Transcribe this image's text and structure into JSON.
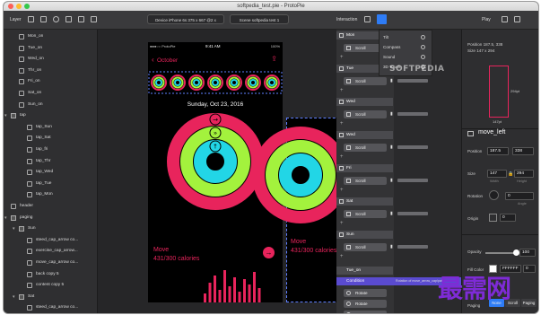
{
  "window": {
    "title": "softpedia_test.pie - ProtoPie",
    "traffic_colors": [
      "#fc5f57",
      "#fdbc2e",
      "#34c84a"
    ]
  },
  "toolbar": {
    "layer_label": "Layer",
    "device_label": "Device  iPhone 6s 375 x 667 @2 x",
    "scene_label": "Scene  softpedia test 1",
    "interaction_label": "Interaction",
    "play_label": "Play"
  },
  "layers": [
    {
      "name": "Mon_on",
      "indent": 1,
      "icon": "image-icon"
    },
    {
      "name": "Tue_on",
      "indent": 1,
      "icon": "image-icon"
    },
    {
      "name": "Wed_on",
      "indent": 1,
      "icon": "image-icon"
    },
    {
      "name": "Thr_on",
      "indent": 1,
      "icon": "image-icon"
    },
    {
      "name": "Fri_on",
      "indent": 1,
      "icon": "image-icon"
    },
    {
      "name": "Sat_on",
      "indent": 1,
      "icon": "image-icon"
    },
    {
      "name": "Sun_on",
      "indent": 1,
      "icon": "image-icon"
    },
    {
      "name": "tap",
      "indent": 0,
      "icon": "folder-icon"
    },
    {
      "name": "tap_Sun",
      "indent": 2,
      "icon": "rect-icon"
    },
    {
      "name": "tap_Sat",
      "indent": 2,
      "icon": "rect-icon"
    },
    {
      "name": "tap_fri",
      "indent": 2,
      "icon": "rect-icon"
    },
    {
      "name": "tap_Thr",
      "indent": 2,
      "icon": "rect-icon"
    },
    {
      "name": "tap_Wed",
      "indent": 2,
      "icon": "rect-icon"
    },
    {
      "name": "tap_Tue",
      "indent": 2,
      "icon": "rect-icon"
    },
    {
      "name": "tap_Mon",
      "indent": 2,
      "icon": "rect-icon"
    },
    {
      "name": "header",
      "indent": 0,
      "icon": "image-icon"
    },
    {
      "name": "paging",
      "indent": 0,
      "icon": "folder-icon"
    },
    {
      "name": "Sun",
      "indent": 1,
      "icon": "folder-icon"
    },
    {
      "name": "steed_cap_arrow co...",
      "indent": 2,
      "icon": "image-icon"
    },
    {
      "name": "exercise_cap_arrow...",
      "indent": 2,
      "icon": "image-icon"
    },
    {
      "name": "move_cap_arrow co...",
      "indent": 2,
      "icon": "image-icon"
    },
    {
      "name": "back copy 5",
      "indent": 2,
      "icon": "image-icon"
    },
    {
      "name": "content copy 5",
      "indent": 2,
      "icon": "image-icon"
    },
    {
      "name": "Sat",
      "indent": 1,
      "icon": "folder-icon"
    },
    {
      "name": "steed_cap_arrow co...",
      "indent": 2,
      "icon": "image-icon"
    }
  ],
  "phone": {
    "status_carrier": "●●●○○ ProtoPie",
    "status_time": "9:41 AM",
    "status_battery": "100%",
    "back_label": "October",
    "date": "Sunday, Oct 23, 2016",
    "move_label": "Move",
    "move_value": "431/300",
    "move_unit": "calories",
    "move2_label": "Move",
    "move2_value": "431/300",
    "move2_unit": "calories"
  },
  "interactions": [
    {
      "trigger": "Mon",
      "action": "Scroll"
    },
    {
      "trigger": "Tue",
      "action": "Scroll"
    },
    {
      "trigger": "Wed",
      "action": "Scroll"
    },
    {
      "trigger": "Wed",
      "action": "Scroll"
    },
    {
      "trigger": "Fri",
      "action": "Scroll"
    },
    {
      "trigger": "Sat",
      "action": "Scroll"
    },
    {
      "trigger": "Sun",
      "action": "Scroll"
    }
  ],
  "tue_on": {
    "label": "Tue_on",
    "condition": "Condition",
    "condition_text": "Rotation of move_arrow_cap/pat...",
    "actions": [
      "Rotate",
      "Rotate",
      "Rotate"
    ]
  },
  "trigger_menu": {
    "items": [
      "Tilt",
      "Compass",
      "Sound",
      "3D Touch"
    ]
  },
  "properties": {
    "layer_name": "move_left",
    "position_label": "Position",
    "x": "187.5",
    "y": "338",
    "size_label": "Size",
    "width": "147",
    "height": "294",
    "width_sub": "Width",
    "height_sub": "Height",
    "rotation_label": "Rotation",
    "rotation_value": "0",
    "angle_sub": "Angle",
    "origin_label": "Origin",
    "origin_x": "0",
    "opacity_label": "Opacity",
    "opacity_value": "100",
    "opacity_fraction": 1.0,
    "fill_label": "Fill Color",
    "fill_value": "FFFFFF",
    "fill_pct": "0",
    "paging_label": "Paging",
    "paging_options": [
      "None",
      "Scroll",
      "Paging"
    ],
    "top_pos": "Position  187.5, 338",
    "top_size": "Size  147 x 294",
    "w_tag": "147pt",
    "h_tag": "294pt"
  },
  "watermark": {
    "softpedia": "SOFTPEDIA",
    "chinese": "最需网"
  },
  "colors": {
    "accent": "#2e7cf6",
    "move_red": "#e8245c",
    "exercise_green": "#a3f23d",
    "stand_cyan": "#22d6e6",
    "selected_purple": "#5a4bd0"
  }
}
